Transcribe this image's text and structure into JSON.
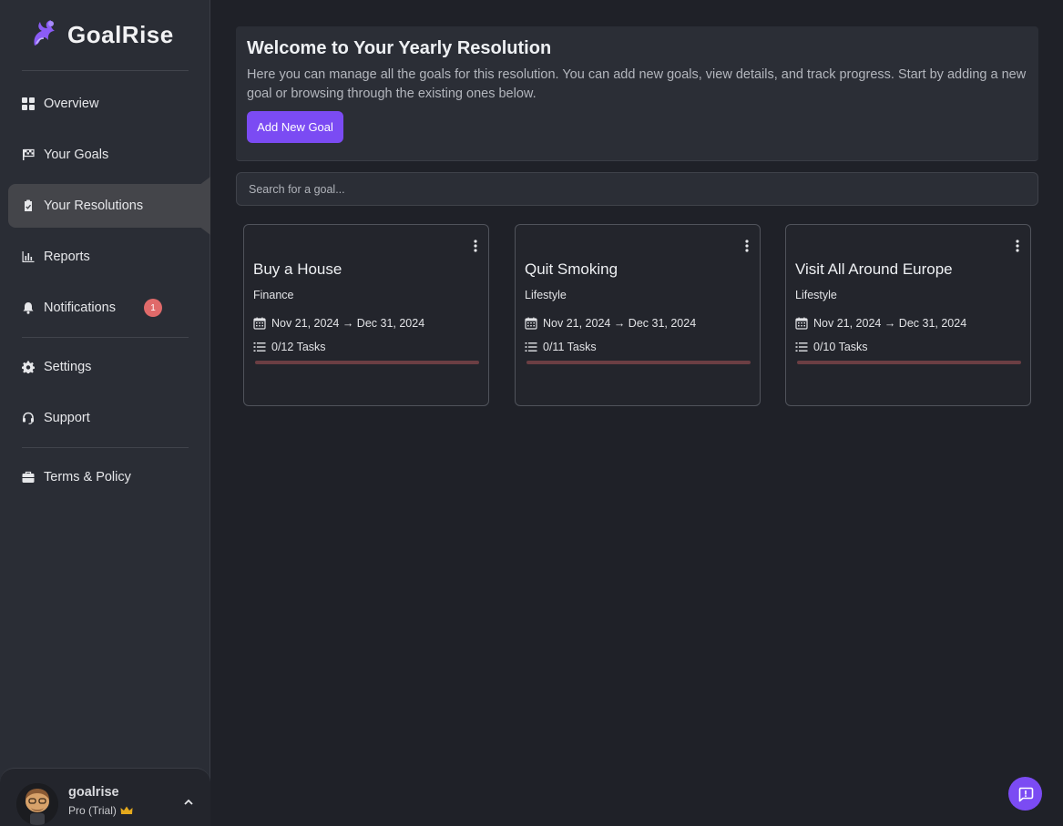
{
  "brand": {
    "name": "GoalRise"
  },
  "sidebar": {
    "items": [
      {
        "label": "Overview",
        "icon": "grid-icon"
      },
      {
        "label": "Your Goals",
        "icon": "flag-icon"
      },
      {
        "label": "Your Resolutions",
        "icon": "clipboard-check-icon",
        "active": true
      },
      {
        "label": "Reports",
        "icon": "bar-chart-icon"
      },
      {
        "label": "Notifications",
        "icon": "bell-icon",
        "badge": "1"
      },
      {
        "label": "Settings",
        "icon": "gear-icon"
      },
      {
        "label": "Support",
        "icon": "headset-icon"
      },
      {
        "label": "Terms & Policy",
        "icon": "briefcase-icon"
      }
    ]
  },
  "user": {
    "name": "goalrise",
    "plan": "Pro (Trial)"
  },
  "welcome": {
    "title": "Welcome to Your Yearly Resolution",
    "description": "Here you can manage all the goals for this resolution. You can add new goals, view details, and track progress. Start by adding a new goal or browsing through the existing ones below.",
    "add_button": "Add New Goal"
  },
  "search": {
    "placeholder": "Search for a goal...",
    "value": ""
  },
  "goals": [
    {
      "title": "Buy a House",
      "category": "Finance",
      "dates": "Nov 21, 2024 → Dec 31, 2024",
      "tasks": "0/12 Tasks",
      "progress": 0
    },
    {
      "title": "Quit Smoking",
      "category": "Lifestyle",
      "dates": "Nov 21, 2024 → Dec 31, 2024",
      "tasks": "0/11 Tasks",
      "progress": 0
    },
    {
      "title": "Visit All Around Europe",
      "category": "Lifestyle",
      "dates": "Nov 21, 2024 → Dec 31, 2024",
      "tasks": "0/10 Tasks",
      "progress": 0
    }
  ],
  "colors": {
    "accent": "#7b4bf3",
    "badge": "#e06a6a",
    "progress_track": "#6b3e43"
  }
}
